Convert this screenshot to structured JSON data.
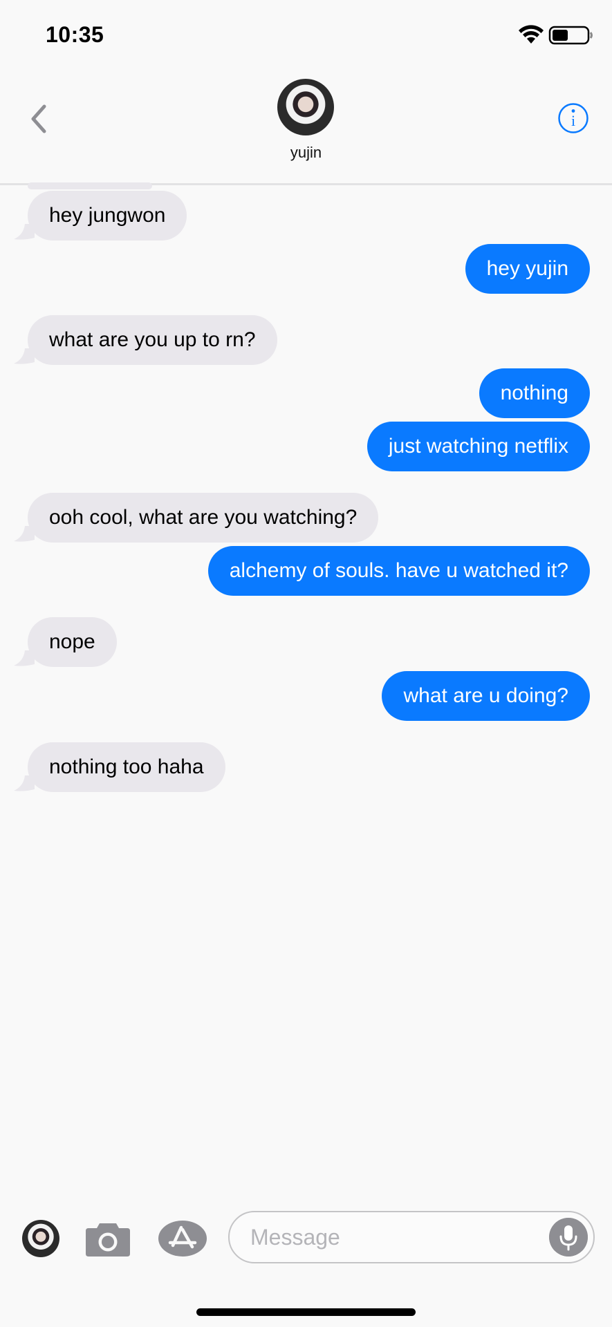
{
  "status_bar": {
    "time": "10:35",
    "wifi_icon": "wifi-icon",
    "battery_icon": "battery-icon"
  },
  "header": {
    "back_icon": "chevron-left-icon",
    "contact_name": "yujin",
    "info_icon": "info-icon"
  },
  "messages": [
    {
      "direction": "in",
      "text": "hey jungwon"
    },
    {
      "direction": "out",
      "text": "hey yujin"
    },
    {
      "direction": "in",
      "text": "what are you up to rn?"
    },
    {
      "direction": "out",
      "text": "nothing"
    },
    {
      "direction": "out",
      "text": "just watching netflix"
    },
    {
      "direction": "in",
      "text": "ooh cool, what are you watching?"
    },
    {
      "direction": "out",
      "text": "alchemy of souls. have u watched it?"
    },
    {
      "direction": "in",
      "text": "nope"
    },
    {
      "direction": "out",
      "text": "what are u doing?"
    },
    {
      "direction": "in",
      "text": "nothing too haha"
    }
  ],
  "input_bar": {
    "placeholder": "Message",
    "camera_icon": "camera-icon",
    "appstore_icon": "app-store-icon",
    "mic_icon": "microphone-icon"
  },
  "colors": {
    "outgoing": "#0a7aff",
    "incoming": "#e9e7ec",
    "accent": "#0a7aff"
  }
}
